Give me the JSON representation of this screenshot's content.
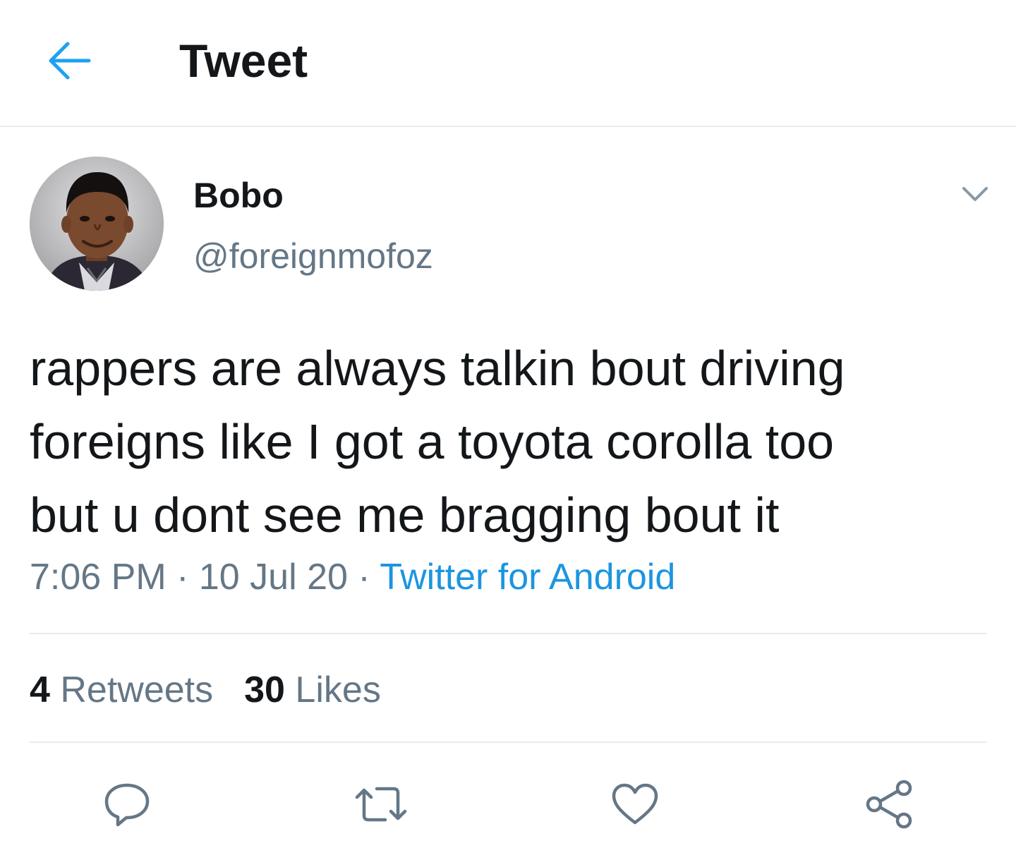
{
  "header": {
    "back_icon": "arrow-left-icon",
    "title": "Tweet"
  },
  "tweet": {
    "author": {
      "display_name": "Bobo",
      "handle": "@foreignmofoz",
      "avatar_icon": "profile-photo"
    },
    "text": "rappers are always talkin bout driving\nforeigns like I got a toyota corolla too\nbut u dont see me bragging bout it",
    "time": "7:06 PM",
    "separator": " · ",
    "date": "10 Jul 20",
    "source": "Twitter for Android",
    "stats": {
      "retweets_count": "4",
      "retweets_label": " Retweets",
      "likes_count": "30",
      "likes_label": " Likes"
    }
  },
  "actions": {
    "reply_icon": "reply-icon",
    "retweet_icon": "retweet-icon",
    "like_icon": "heart-icon",
    "share_icon": "share-icon"
  },
  "colors": {
    "accent": "#1da1f2",
    "link": "#1b95e0",
    "secondary_text": "#657786",
    "primary_text": "#14171a",
    "divider": "#e6ecf0"
  }
}
